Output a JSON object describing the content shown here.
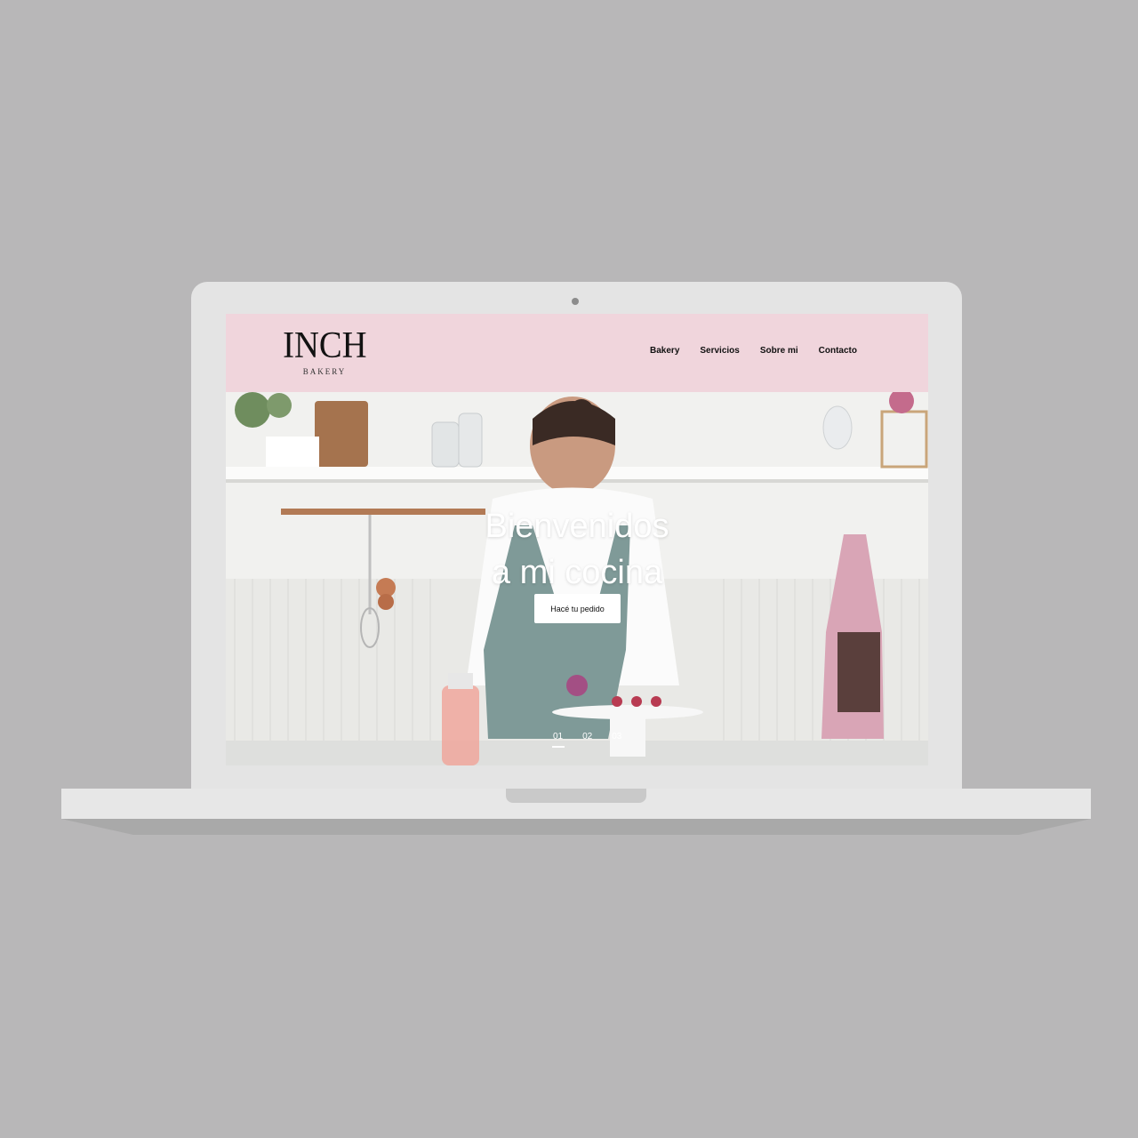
{
  "site": {
    "logo_main": "INCH",
    "logo_sub": "BAKERY",
    "nav": [
      "Bakery",
      "Servicios",
      "Sobre mi",
      "Contacto"
    ],
    "hero": {
      "title_line1": "Bienvenidos",
      "title_line2": "a mi cocina",
      "cta_label": "Hacé tu pedido",
      "slides": [
        "01",
        "02",
        "03"
      ],
      "active_slide": "01"
    }
  },
  "colors": {
    "background": "#b8b7b8",
    "header_pink": "#f0d5dc",
    "laptop_body": "#e4e4e4"
  }
}
